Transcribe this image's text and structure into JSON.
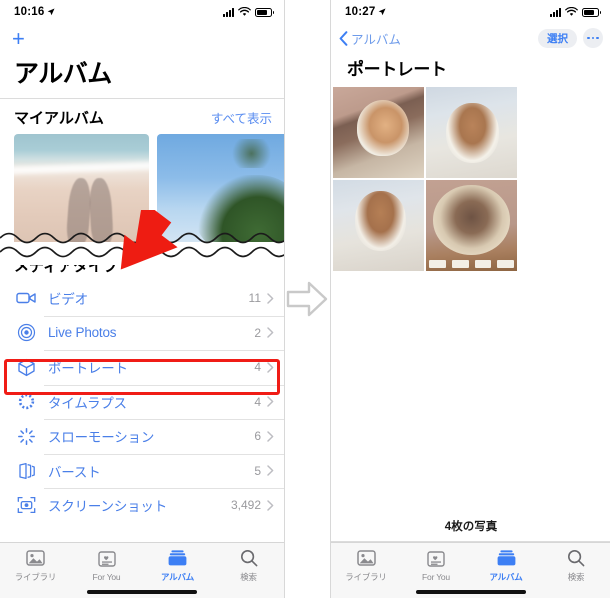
{
  "left": {
    "status": {
      "time": "10:16",
      "location_icon": "location-arrow-icon",
      "signal_icon": "cellular-signal-icon",
      "wifi_icon": "wifi-icon",
      "battery_icon": "battery-icon"
    },
    "add_button_label": "+",
    "page_title": "アルバム",
    "my_albums": {
      "heading": "マイアルバム",
      "see_all_label": "すべて表示"
    },
    "media_types": {
      "heading": "メディアタイプ",
      "items": [
        {
          "icon": "video-camera-icon",
          "label": "ビデオ",
          "count": "11"
        },
        {
          "icon": "live-photos-icon",
          "label": "Live Photos",
          "count": "2"
        },
        {
          "icon": "portrait-cube-icon",
          "label": "ポートレート",
          "count": "4"
        },
        {
          "icon": "timelapse-icon",
          "label": "タイムラプス",
          "count": "4"
        },
        {
          "icon": "slow-motion-icon",
          "label": "スローモーション",
          "count": "6"
        },
        {
          "icon": "burst-icon",
          "label": "バースト",
          "count": "5"
        },
        {
          "icon": "screenshot-icon",
          "label": "スクリーンショット",
          "count": "3,492"
        }
      ],
      "highlighted_index": 2,
      "highlight_color": "#f01c16"
    },
    "tabs": [
      {
        "icon": "library-icon",
        "label": "ライブラリ",
        "active": false
      },
      {
        "icon": "for-you-icon",
        "label": "For You",
        "active": false
      },
      {
        "icon": "albums-icon",
        "label": "アルバム",
        "active": true
      },
      {
        "icon": "search-icon",
        "label": "検索",
        "active": false
      }
    ]
  },
  "right": {
    "status": {
      "time": "10:27",
      "location_icon": "location-arrow-icon",
      "signal_icon": "cellular-signal-icon",
      "wifi_icon": "wifi-icon",
      "battery_icon": "battery-icon"
    },
    "back_label": "アルバム",
    "select_label": "選択",
    "more_label": "•••",
    "page_title": "ポートレート",
    "photo_count_label": "4枚の写真",
    "photos": [
      {
        "alt": "cat-photo-1"
      },
      {
        "alt": "cat-photo-2"
      },
      {
        "alt": "cat-photo-3"
      },
      {
        "alt": "cat-photo-4"
      }
    ],
    "tabs": [
      {
        "icon": "library-icon",
        "label": "ライブラリ",
        "active": false
      },
      {
        "icon": "for-you-icon",
        "label": "For You",
        "active": false
      },
      {
        "icon": "albums-icon",
        "label": "アルバム",
        "active": true
      },
      {
        "icon": "search-icon",
        "label": "検索",
        "active": false
      }
    ]
  },
  "annotations": {
    "flow_arrow_icon": "right-arrow-outline-icon",
    "red_pointer_icon": "red-arrow-pointer-icon",
    "accent_blue": "#3d7ff4",
    "link_blue": "#4a7fe8",
    "highlight_red": "#f01c16"
  }
}
